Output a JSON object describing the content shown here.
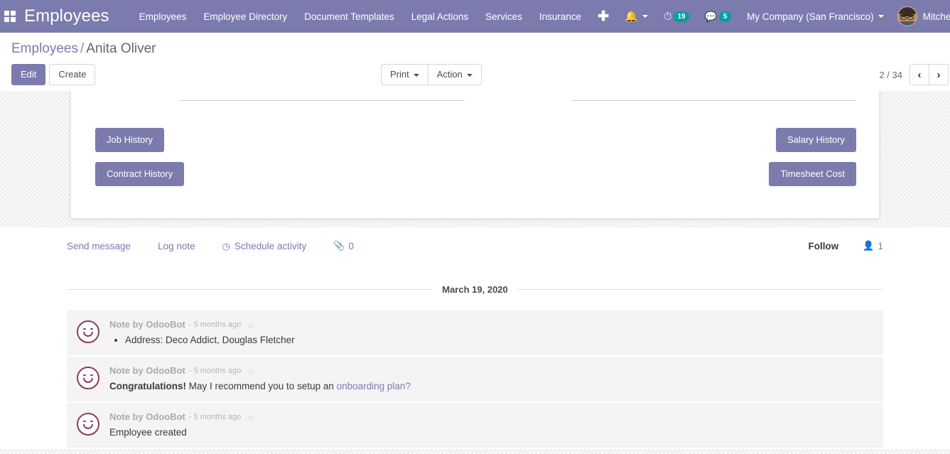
{
  "navbar": {
    "apps_icon": "apps-grid-icon",
    "brand": "Employees",
    "menu_items": [
      {
        "label": "Employees"
      },
      {
        "label": "Employee Directory"
      },
      {
        "label": "Document Templates"
      },
      {
        "label": "Legal Actions"
      },
      {
        "label": "Services"
      },
      {
        "label": "Insurance"
      }
    ],
    "plus_icon": "plus-icon",
    "bell_icon": "bell-icon",
    "activities": {
      "icon": "clock-icon",
      "count": "19"
    },
    "messages": {
      "icon": "chat-bubble-icon",
      "count": "5"
    },
    "company": "My Company (San Francisco)",
    "user": "Mitchell Admin",
    "accent_color": "#7c7bad",
    "badge_color": "#00a09d"
  },
  "control_panel": {
    "breadcrumb": {
      "root": "Employees",
      "separator": "/",
      "current": "Anita Oliver"
    },
    "edit_label": "Edit",
    "create_label": "Create",
    "print_label": "Print",
    "action_label": "Action",
    "pager": {
      "value": "2 / 34",
      "prev_icon": "chevron-left-icon",
      "next_icon": "chevron-right-icon"
    }
  },
  "form": {
    "stat_rows": [
      {
        "left": "Job History",
        "right": "Salary History"
      },
      {
        "left": "Contract History",
        "right": "Timesheet Cost"
      }
    ]
  },
  "chatter": {
    "send_message": "Send message",
    "log_note": "Log note",
    "schedule_activity": "Schedule activity",
    "schedule_icon": "clock-icon",
    "attachment_icon": "paperclip-icon",
    "attachment_count": "0",
    "follow_label": "Follow",
    "follower_icon": "user-icon",
    "follower_count": "1",
    "date_separator": "March 19, 2020",
    "messages": [
      {
        "author": "Note by OdooBot",
        "time": "- 5 months ago",
        "star_icon": "star-outline-icon",
        "avatar_icon": "odoobot-smiley-avatar",
        "type": "bullet",
        "bullet": "Address: Deco Addict, Douglas Fletcher"
      },
      {
        "author": "Note by OdooBot",
        "time": "- 5 months ago",
        "star_icon": "star-outline-icon",
        "avatar_icon": "odoobot-smiley-avatar",
        "type": "rich",
        "bold_text": "Congratulations!",
        "plain_text": " May I recommend you to setup an ",
        "link_text": "onboarding plan?"
      },
      {
        "author": "Note by OdooBot",
        "time": "- 5 months ago",
        "star_icon": "star-outline-icon",
        "avatar_icon": "odoobot-smiley-avatar",
        "type": "plain",
        "text": "Employee created"
      }
    ]
  }
}
